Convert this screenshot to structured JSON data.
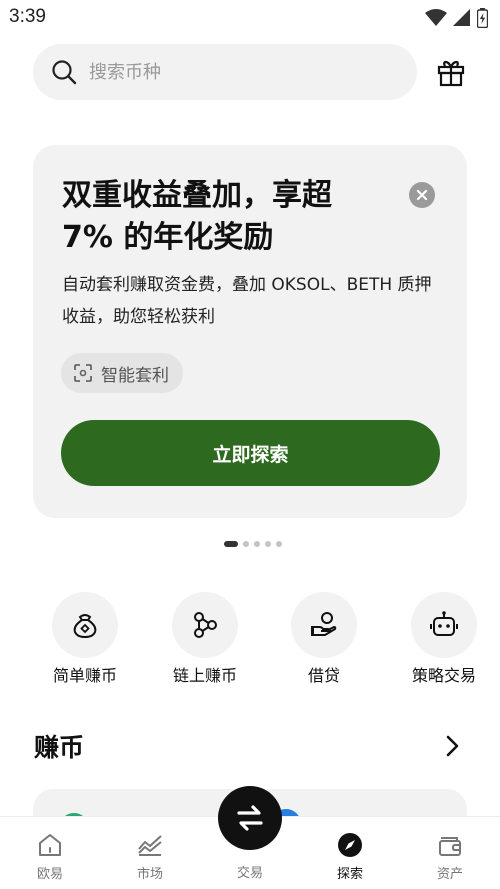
{
  "status_bar": {
    "time": "3:39"
  },
  "search": {
    "placeholder": "搜索币种"
  },
  "promo": {
    "title": "双重收益叠加，享超 7% 的年化奖励",
    "description": "自动套利赚取资金费，叠加 OKSOL、BETH 质押收益，助您轻松获利",
    "tag_label": "智能套利",
    "button_label": "立即探索",
    "carousel_total": 5,
    "carousel_active": 1
  },
  "quick_actions": [
    {
      "label": "简单赚币",
      "icon": "money-bag-icon"
    },
    {
      "label": "链上赚币",
      "icon": "chain-nodes-icon"
    },
    {
      "label": "借贷",
      "icon": "hand-coin-icon"
    },
    {
      "label": "策略交易",
      "icon": "robot-icon"
    }
  ],
  "section": {
    "title": "赚币"
  },
  "bottom_nav": {
    "items": [
      {
        "label": "欧易",
        "icon": "home-icon"
      },
      {
        "label": "市场",
        "icon": "market-chart-icon"
      },
      {
        "label": "交易",
        "icon": "swap-arrows-icon"
      },
      {
        "label": "探索",
        "icon": "compass-icon",
        "active": true
      },
      {
        "label": "资产",
        "icon": "wallet-icon"
      }
    ]
  },
  "colors": {
    "accent_green": "#2d6a1f",
    "card_bg": "#f2f2f2",
    "trade_button": "#111111"
  }
}
